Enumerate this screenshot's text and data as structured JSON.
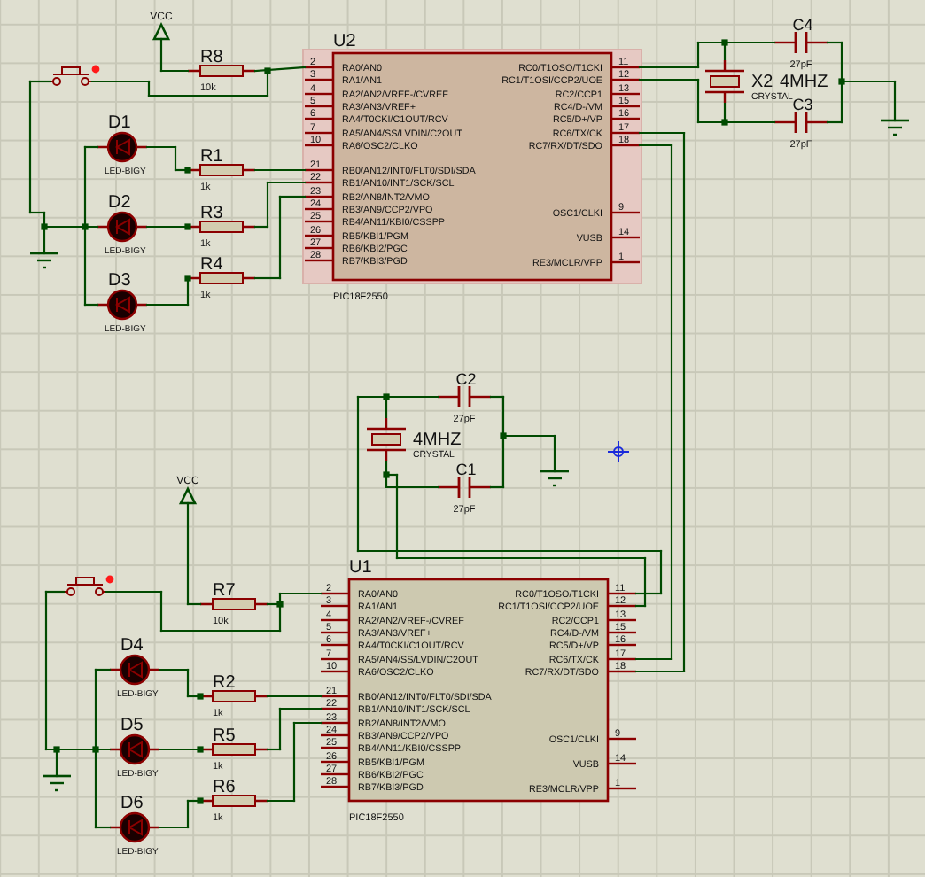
{
  "chips": [
    {
      "reference": "U2",
      "part": "PIC18F2550",
      "selected": true,
      "left_pins": [
        {
          "number": "2",
          "label": "RA0/AN0"
        },
        {
          "number": "3",
          "label": "RA1/AN1"
        },
        {
          "number": "4",
          "label": "RA2/AN2/VREF-/CVREF"
        },
        {
          "number": "5",
          "label": "RA3/AN3/VREF+"
        },
        {
          "number": "6",
          "label": "RA4/T0CKI/C1OUT/RCV"
        },
        {
          "number": "7",
          "label": "RA5/AN4/SS/LVDIN/C2OUT"
        },
        {
          "number": "10",
          "label": "RA6/OSC2/CLKO"
        },
        {
          "number": "21",
          "label": "RB0/AN12/INT0/FLT0/SDI/SDA"
        },
        {
          "number": "22",
          "label": "RB1/AN10/INT1/SCK/SCL"
        },
        {
          "number": "23",
          "label": "RB2/AN8/INT2/VMO"
        },
        {
          "number": "24",
          "label": "RB3/AN9/CCP2/VPO"
        },
        {
          "number": "25",
          "label": "RB4/AN11/KBI0/CSSPP"
        },
        {
          "number": "26",
          "label": "RB5/KBI1/PGM"
        },
        {
          "number": "27",
          "label": "RB6/KBI2/PGC"
        },
        {
          "number": "28",
          "label": "RB7/KBI3/PGD"
        }
      ],
      "right_pins": [
        {
          "number": "11",
          "label": "RC0/T1OSO/T1CKI"
        },
        {
          "number": "12",
          "label": "RC1/T1OSI/CCP2/UOE"
        },
        {
          "number": "13",
          "label": "RC2/CCP1"
        },
        {
          "number": "15",
          "label": "RC4/D-/VM"
        },
        {
          "number": "16",
          "label": "RC5/D+/VP"
        },
        {
          "number": "17",
          "label": "RC6/TX/CK"
        },
        {
          "number": "18",
          "label": "RC7/RX/DT/SDO"
        },
        {
          "number": "9",
          "label": "OSC1/CLKI"
        },
        {
          "number": "14",
          "label": "VUSB"
        },
        {
          "number": "1",
          "label": "RE3/MCLR/VPP"
        }
      ]
    },
    {
      "reference": "U1",
      "part": "PIC18F2550",
      "selected": false,
      "left_pins": [
        {
          "number": "2",
          "label": "RA0/AN0"
        },
        {
          "number": "3",
          "label": "RA1/AN1"
        },
        {
          "number": "4",
          "label": "RA2/AN2/VREF-/CVREF"
        },
        {
          "number": "5",
          "label": "RA3/AN3/VREF+"
        },
        {
          "number": "6",
          "label": "RA4/T0CKI/C1OUT/RCV"
        },
        {
          "number": "7",
          "label": "RA5/AN4/SS/LVDIN/C2OUT"
        },
        {
          "number": "10",
          "label": "RA6/OSC2/CLKO"
        },
        {
          "number": "21",
          "label": "RB0/AN12/INT0/FLT0/SDI/SDA"
        },
        {
          "number": "22",
          "label": "RB1/AN10/INT1/SCK/SCL"
        },
        {
          "number": "23",
          "label": "RB2/AN8/INT2/VMO"
        },
        {
          "number": "24",
          "label": "RB3/AN9/CCP2/VPO"
        },
        {
          "number": "25",
          "label": "RB4/AN11/KBI0/CSSPP"
        },
        {
          "number": "26",
          "label": "RB5/KBI1/PGM"
        },
        {
          "number": "27",
          "label": "RB6/KBI2/PGC"
        },
        {
          "number": "28",
          "label": "RB7/KBI3/PGD"
        }
      ],
      "right_pins": [
        {
          "number": "11",
          "label": "RC0/T1OSO/T1CKI"
        },
        {
          "number": "12",
          "label": "RC1/T1OSI/CCP2/UOE"
        },
        {
          "number": "13",
          "label": "RC2/CCP1"
        },
        {
          "number": "15",
          "label": "RC4/D-/VM"
        },
        {
          "number": "16",
          "label": "RC5/D+/VP"
        },
        {
          "number": "17",
          "label": "RC6/TX/CK"
        },
        {
          "number": "18",
          "label": "RC7/RX/DT/SDO"
        },
        {
          "number": "9",
          "label": "OSC1/CLKI"
        },
        {
          "number": "14",
          "label": "VUSB"
        },
        {
          "number": "1",
          "label": "RE3/MCLR/VPP"
        }
      ]
    }
  ],
  "resistors": [
    {
      "reference": "R8",
      "value": "10k"
    },
    {
      "reference": "R1",
      "value": "1k"
    },
    {
      "reference": "R3",
      "value": "1k"
    },
    {
      "reference": "R4",
      "value": "1k"
    },
    {
      "reference": "R7",
      "value": "10k"
    },
    {
      "reference": "R2",
      "value": "1k"
    },
    {
      "reference": "R5",
      "value": "1k"
    },
    {
      "reference": "R6",
      "value": "1k"
    }
  ],
  "leds": [
    {
      "reference": "D1",
      "value": "LED-BIGY"
    },
    {
      "reference": "D2",
      "value": "LED-BIGY"
    },
    {
      "reference": "D3",
      "value": "LED-BIGY"
    },
    {
      "reference": "D4",
      "value": "LED-BIGY"
    },
    {
      "reference": "D5",
      "value": "LED-BIGY"
    },
    {
      "reference": "D6",
      "value": "LED-BIGY"
    }
  ],
  "capacitors": [
    {
      "reference": "C4",
      "value": "27pF"
    },
    {
      "reference": "C3",
      "value": "27pF"
    },
    {
      "reference": "C2",
      "value": "27pF"
    },
    {
      "reference": "C1",
      "value": "27pF"
    }
  ],
  "crystals": [
    {
      "reference": "X2",
      "value": "4MHZ",
      "type_label": "CRYSTAL"
    },
    {
      "value": "4MHZ",
      "type_label": "CRYSTAL"
    }
  ],
  "power_terminals": [
    {
      "label": "VCC"
    },
    {
      "label": "VCC"
    }
  ]
}
